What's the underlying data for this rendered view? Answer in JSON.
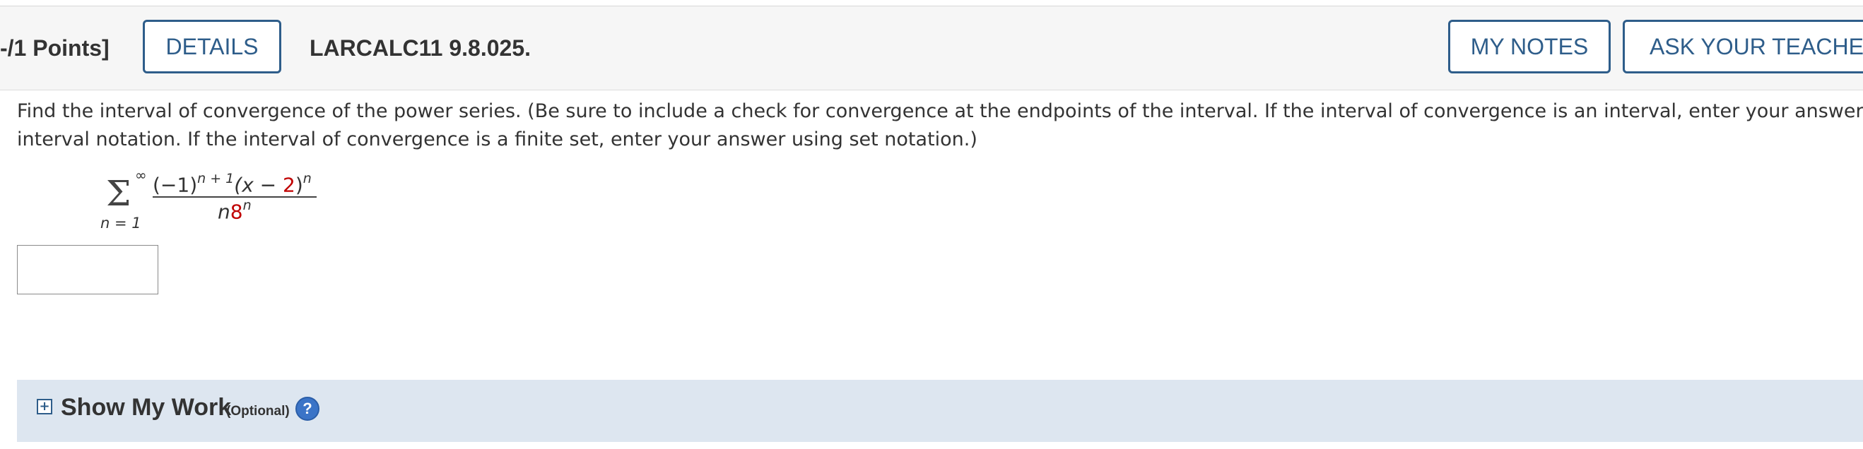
{
  "header": {
    "points": "-/1 Points]",
    "details_label": "DETAILS",
    "question_id": "LARCALC11 9.8.025.",
    "my_notes_label": "MY NOTES",
    "ask_teacher_label": "ASK YOUR TEACHER"
  },
  "question": {
    "line1": "Find the interval of convergence of the power series. (Be sure to include a check for convergence at the endpoints of the interval. If the interval of convergence is an interval, enter your answer using",
    "line2": "interval notation. If the interval of convergence is a finite set, enter your answer using set notation.)"
  },
  "formula": {
    "upper_limit": "∞",
    "sigma": "Σ",
    "lower_limit": "n = 1",
    "numerator_base": "(−1)",
    "numerator_exp": "n + 1",
    "numerator_x": "(x − ",
    "numerator_shift": "2",
    "numerator_close": ")",
    "numerator_x_exp": "n",
    "denominator_n": "n",
    "denominator_base": "8",
    "denominator_exp": "n"
  },
  "answer": {
    "value": ""
  },
  "show_work": {
    "expand_icon": "plus-box-icon",
    "expand_symbol": "+",
    "title": "Show My Work",
    "optional": "(Optional)",
    "help_symbol": "?"
  },
  "colors": {
    "accent": "#2e5d8a",
    "highlight": "#c00000",
    "work_bg": "#dde6f0",
    "header_bg": "#f6f6f6"
  }
}
